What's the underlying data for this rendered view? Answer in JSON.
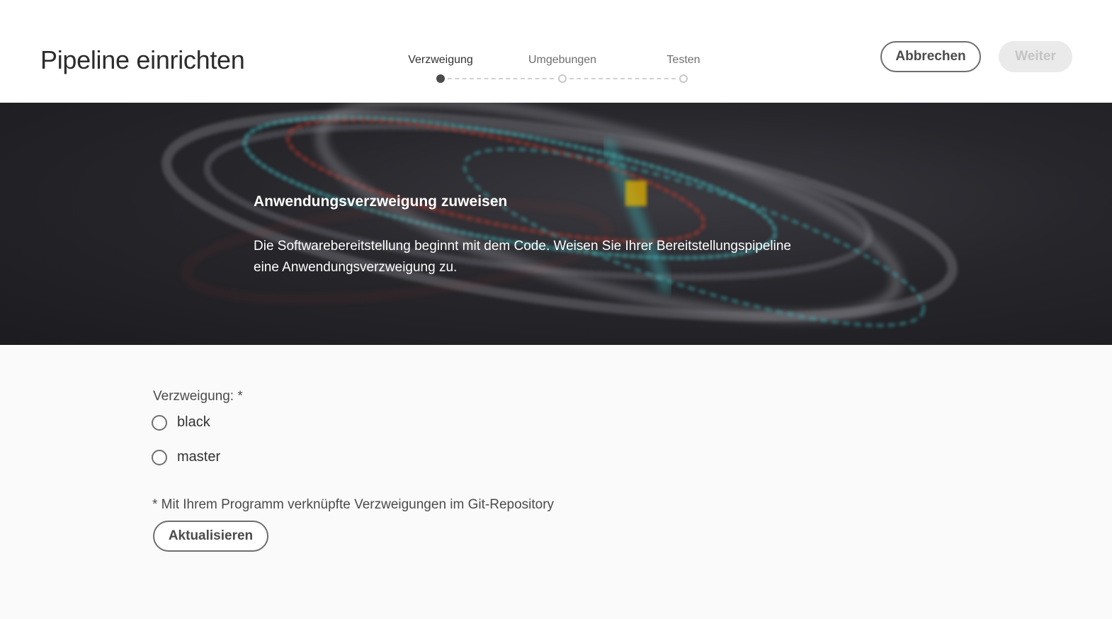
{
  "header": {
    "title": "Pipeline einrichten",
    "steps": [
      {
        "label": "Verzweigung",
        "active": true
      },
      {
        "label": "Umgebungen",
        "active": false
      },
      {
        "label": "Testen",
        "active": false
      }
    ],
    "cancel_label": "Abbrechen",
    "next_label": "Weiter"
  },
  "hero": {
    "title": "Anwendungsverzweigung zuweisen",
    "text": "Die Softwarebereitstellung beginnt mit dem Code. Weisen Sie Ihrer Bereitstellungspipeline eine Anwendungsverzweigung zu."
  },
  "form": {
    "label": "Verzweigung: *",
    "options": [
      {
        "label": "black",
        "selected": false
      },
      {
        "label": "master",
        "selected": false
      }
    ],
    "footnote": "* Mit Ihrem Programm verknüpfte Verzweigungen im Git-Repository",
    "refresh_label": "Aktualisieren"
  },
  "colors": {
    "hero_background": "#26262b",
    "accent_red": "#c0392b",
    "accent_teal": "#3fb6b8",
    "accent_yellow": "#e0b000"
  }
}
